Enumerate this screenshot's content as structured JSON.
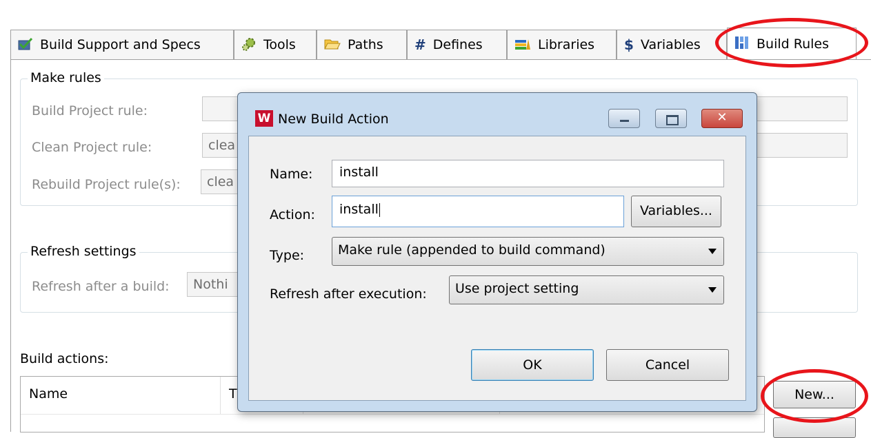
{
  "tabs": [
    {
      "label": "Build Support and Specs",
      "icon": "check-icon"
    },
    {
      "label": "Tools",
      "icon": "gear-icon"
    },
    {
      "label": "Paths",
      "icon": "folder-icon"
    },
    {
      "label": "Defines",
      "icon": "hash-icon"
    },
    {
      "label": "Libraries",
      "icon": "books-icon"
    },
    {
      "label": "Variables",
      "icon": "dollar-icon"
    },
    {
      "label": "Build Rules",
      "icon": "build-rules-icon"
    }
  ],
  "make_rules": {
    "title": "Make rules",
    "build_label": "Build Project rule:",
    "build_value": "",
    "clean_label": "Clean Project rule:",
    "clean_value": "clea",
    "rebuild_label": "Rebuild Project rule(s):",
    "rebuild_value": "clea"
  },
  "refresh_settings": {
    "title": "Refresh settings",
    "label": "Refresh after a build:",
    "value": "Nothi"
  },
  "build_actions": {
    "label": "Build actions:",
    "columns": [
      "Name",
      "T"
    ],
    "new_button": "New..."
  },
  "dialog": {
    "title": "New Build Action",
    "logo_letter": "W",
    "name_label": "Name:",
    "name_value": "install",
    "action_label": "Action:",
    "action_value": "install",
    "variables_button": "Variables...",
    "type_label": "Type:",
    "type_value": "Make rule (appended to build command)",
    "refresh_label": "Refresh after execution:",
    "refresh_value": "Use project setting",
    "ok_button": "OK",
    "cancel_button": "Cancel"
  },
  "colors": {
    "highlight": "#e8151b",
    "dialog_frame": "#c7dbef",
    "close_button": "#c9463d"
  }
}
